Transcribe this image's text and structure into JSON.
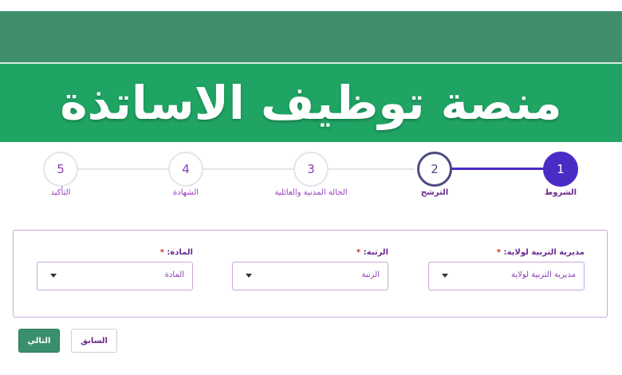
{
  "banner": {
    "title": "منصة توظيف الاساتذة"
  },
  "colors": {
    "banner_green": "#1fa463",
    "dark_band": "#3f8f6c",
    "accent_purple": "#4b2bc6",
    "label_purple": "#6a2a8e"
  },
  "stepper": {
    "steps": [
      {
        "number": "1",
        "label": "الشروط",
        "state": "done"
      },
      {
        "number": "2",
        "label": "الترشح",
        "state": "current"
      },
      {
        "number": "3",
        "label": "الحالة المدنية والعائلية",
        "state": "pending"
      },
      {
        "number": "4",
        "label": "الشهادة",
        "state": "pending"
      },
      {
        "number": "5",
        "label": "التأكيد",
        "state": "pending"
      }
    ]
  },
  "form": {
    "directorate": {
      "label": "مديرية التربية لولاية:",
      "required_mark": "*",
      "value": "مديرية التربية لولاية"
    },
    "rank": {
      "label": "الرتبة:",
      "required_mark": "*",
      "value": "الرتبة"
    },
    "subject": {
      "label": "المادة:",
      "required_mark": "*",
      "value": "المادة"
    }
  },
  "buttons": {
    "next": "التالي",
    "previous": "السابق"
  },
  "icons": {
    "select_caret": "caret-down-icon"
  }
}
